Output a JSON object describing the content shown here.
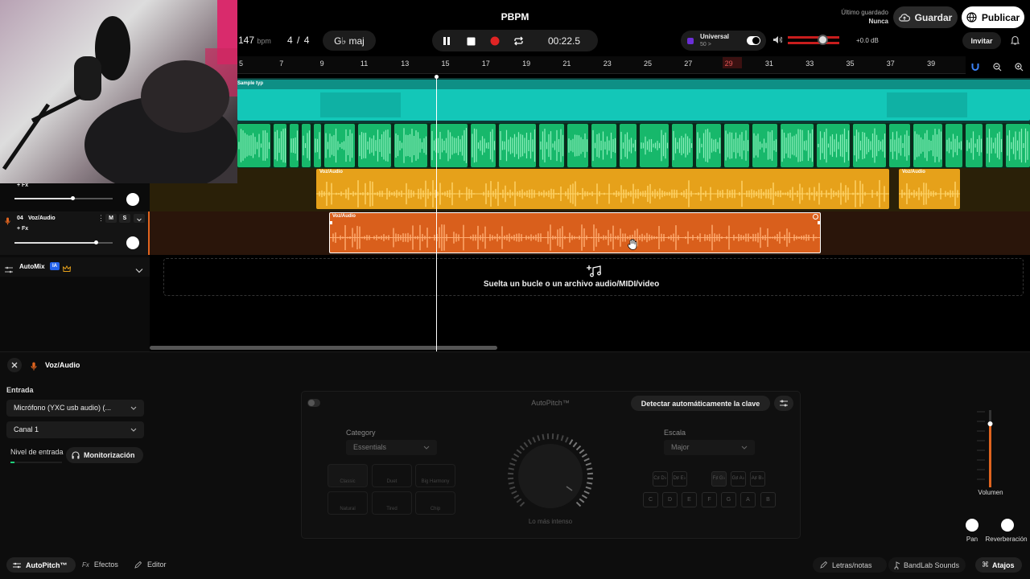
{
  "header": {
    "project_title": "PBPM",
    "last_saved_label": "Último guardado",
    "last_saved_value": "Nunca",
    "save_label": "Guardar",
    "publish_label": "Publicar",
    "invite_label": "Invitar"
  },
  "transport": {
    "tempo": "147",
    "tempo_unit": "bpm",
    "time_sig_num": "4",
    "time_sig_sep": "/",
    "time_sig_den": "4",
    "key": "G♭ maj",
    "time": "00:22.5",
    "universal_label": "Universal",
    "universal_sub": "50 >",
    "volume_db": "+0.0 dB"
  },
  "ruler": [
    "5",
    "7",
    "9",
    "11",
    "13",
    "15",
    "17",
    "19",
    "21",
    "23",
    "25",
    "27",
    "29",
    "31",
    "33",
    "35",
    "37",
    "39"
  ],
  "tracks": {
    "track1_clip": "Sample typ",
    "track3_clip1": "Voz/Audio",
    "track3_clip2": "Voz/Audio",
    "track3_fx": "+ Fx",
    "track4_num": "04",
    "track4_name": "Voz/Audio",
    "track4_m": "M",
    "track4_s": "S",
    "track4_fx": "+ Fx",
    "track4_clip": "Voz/Audio",
    "automix_label": "AutoMix",
    "automix_badge": "IA",
    "drop_text": "Suelta un bucle o un archivo audio/MIDI/video"
  },
  "panel": {
    "title": "Voz/Audio",
    "input_label": "Entrada",
    "input_value": "Micrófono (YXC usb audio) (...",
    "channel_value": "Canal 1",
    "level_label": "Nivel de entrada",
    "monitor_label": "Monitorización",
    "plugin_title": "AutoPitch™",
    "detect_label": "Detectar automáticamente la clave",
    "category_label": "Category",
    "category_value": "Essentials",
    "scale_label": "Escala",
    "scale_value": "Major",
    "knob_caption": "Lo más intenso",
    "presets": [
      "Classic",
      "Duet",
      "Big Harmony",
      "Natural",
      "Tired",
      "Chip"
    ],
    "keys_top": [
      "C♯ D♭",
      "D♯ E♭",
      "F♯ G♭",
      "G♯ A♭",
      "A♯ B♭"
    ],
    "keys_bottom": [
      "C",
      "D",
      "E",
      "F",
      "G",
      "A",
      "B"
    ],
    "volume_label": "Volumen",
    "pan_label": "Pan",
    "reverb_label": "Reverberación"
  },
  "footer": {
    "autopitch_tab": "AutoPitch™",
    "effects_tab": "Efectos",
    "editor_tab": "Editor",
    "lyrics": "Letras/notas",
    "sounds": "BandLab Sounds",
    "shortcuts": "Atajos"
  },
  "colors": {
    "teal": "#14d3c4",
    "green": "#1fce79",
    "yellow": "#e6a11a",
    "orange": "#e0641f",
    "record": "#e02424",
    "accent_purple": "#6b2fd6"
  }
}
